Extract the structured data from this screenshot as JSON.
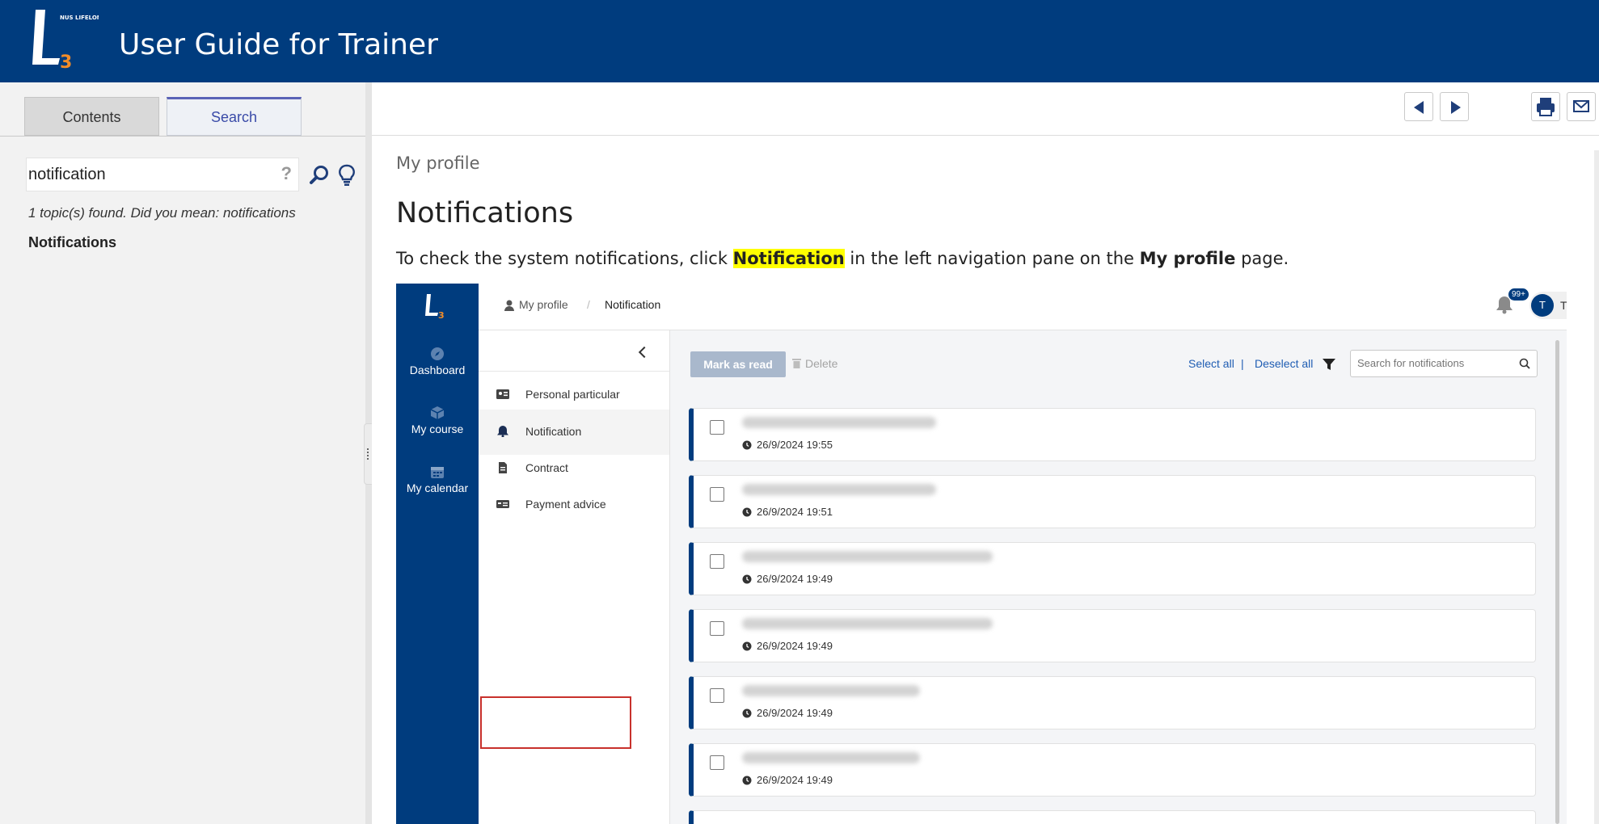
{
  "header": {
    "logo_text": "NUS LIFELONG LEARNING",
    "title": "User Guide for Trainer"
  },
  "nav_panel": {
    "tabs": [
      "Contents",
      "Search"
    ],
    "active_tab": "Search",
    "search": {
      "value": "notification",
      "help_glyph": "?"
    },
    "results_message": "1 topic(s) found. Did you mean: notifications",
    "results": [
      "Notifications"
    ]
  },
  "topic": {
    "breadcrumb": "My profile",
    "title": "Notifications",
    "intro_before": "To check the system notifications, click ",
    "intro_highlight": "Notification",
    "intro_middle": " in the left navigation pane on the ",
    "intro_bold": "My profile",
    "intro_after": " page."
  },
  "screenshot": {
    "rail": [
      {
        "label": "Dashboard",
        "icon": "compass-icon"
      },
      {
        "label": "My course",
        "icon": "box-icon"
      },
      {
        "label": "My calendar",
        "icon": "calendar-icon"
      }
    ],
    "breadcrumb": [
      "My profile",
      "Notification"
    ],
    "breadcrumb_sep": "/",
    "bell_badge": "99+",
    "user": {
      "initial": "T",
      "name": "Trainer"
    },
    "menu": [
      "Personal particular",
      "Notification",
      "Contract",
      "Payment advice"
    ],
    "menu_selected": "Notification",
    "toolbar": {
      "mark_as_read": "Mark as read",
      "delete": "Delete",
      "select_all": "Select all",
      "separator": "|",
      "deselect_all": "Deselect all",
      "search_placeholder": "Search for notifications"
    },
    "notifications": [
      {
        "time": "26/9/2024 19:55"
      },
      {
        "time": "26/9/2024 19:51"
      },
      {
        "time": "26/9/2024 19:49"
      },
      {
        "time": "26/9/2024 19:49"
      },
      {
        "time": "26/9/2024 19:49"
      },
      {
        "time": "26/9/2024 19:49"
      }
    ]
  },
  "colors": {
    "brand": "#003c7e",
    "highlight": "#ffff00",
    "callout": "#c8312c",
    "link": "#1f5db3"
  }
}
